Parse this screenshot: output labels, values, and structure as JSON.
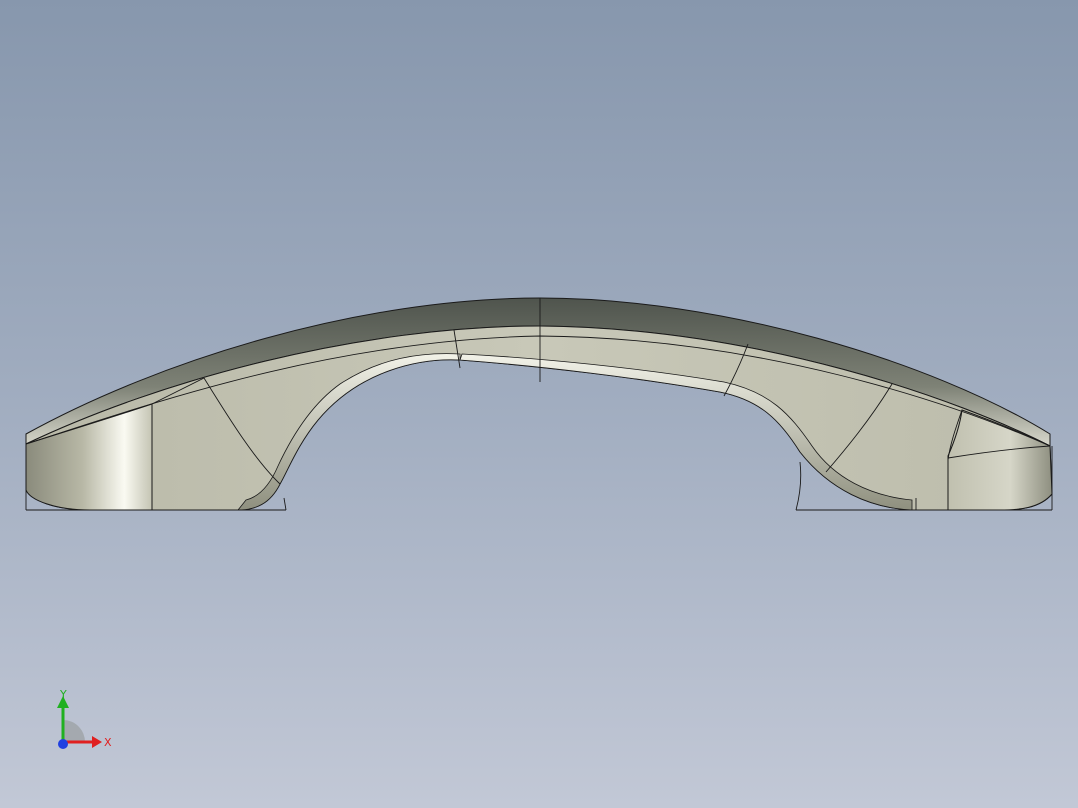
{
  "viewport": {
    "view": "front",
    "model": "handle part"
  },
  "triad": {
    "x_label": "X",
    "y_label": "Y",
    "x_color": "#e02020",
    "y_color": "#20b020",
    "z_color": "#2040e0"
  },
  "colors": {
    "body_face": "#c4c4b4",
    "top_surface_dark": "#5a5f57",
    "edge_line": "#1a1a1a"
  },
  "icons": [
    "coordinate-triad-icon"
  ]
}
